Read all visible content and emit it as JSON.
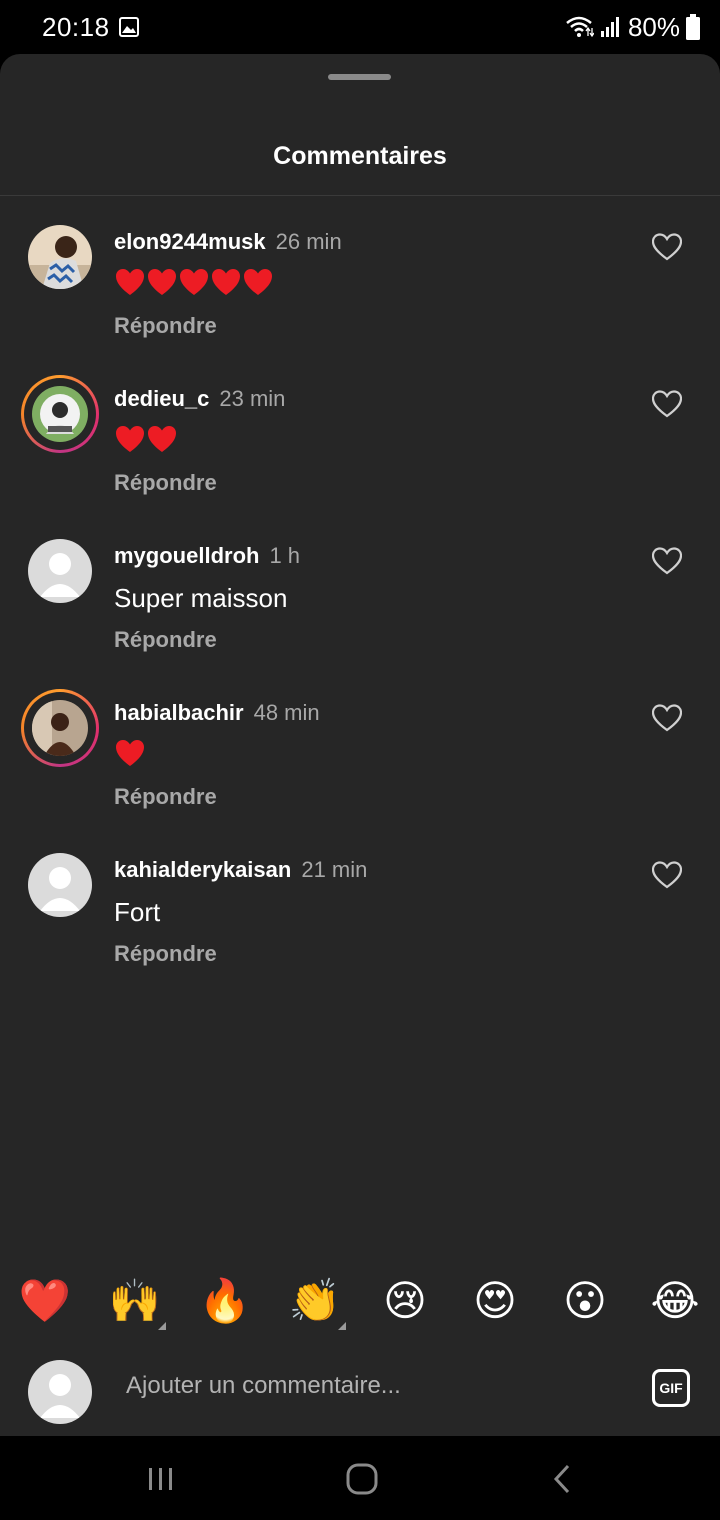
{
  "status_bar": {
    "time": "20:18",
    "battery": "80%",
    "icons": [
      "gallery-icon",
      "wifi-icon",
      "signal-icon",
      "battery-icon"
    ]
  },
  "sheet": {
    "title": "Commentaires"
  },
  "comments": [
    {
      "username": "elon9244musk",
      "time": "26 min",
      "text": "",
      "hearts": 5,
      "reply": "Répondre",
      "has_story_ring": false
    },
    {
      "username": "dedieu_c",
      "time": "23 min",
      "text": "",
      "hearts": 2,
      "reply": "Répondre",
      "has_story_ring": true
    },
    {
      "username": "mygouelldroh",
      "time": "1 h",
      "text": "Super maisson",
      "hearts": 0,
      "reply": "Répondre",
      "has_story_ring": false
    },
    {
      "username": "habialbachir",
      "time": "48 min",
      "text": "",
      "hearts": 1,
      "reply": "Répondre",
      "has_story_ring": true
    },
    {
      "username": "kahialderykaisan",
      "time": "21 min",
      "text": "Fort",
      "hearts": 0,
      "reply": "Répondre",
      "has_story_ring": false
    }
  ],
  "reactions": [
    {
      "emoji": "❤️",
      "name": "red-heart"
    },
    {
      "emoji": "🙌",
      "name": "raising-hands",
      "has_variants": true
    },
    {
      "emoji": "🔥",
      "name": "fire"
    },
    {
      "emoji": "👏",
      "name": "clapping-hands",
      "has_variants": true
    },
    {
      "emoji": "😢",
      "name": "crying-face"
    },
    {
      "emoji": "😍",
      "name": "heart-eyes"
    },
    {
      "emoji": "😮",
      "name": "surprised-face"
    },
    {
      "emoji": "😂",
      "name": "tears-of-joy"
    }
  ],
  "input": {
    "placeholder": "Ajouter un commentaire...",
    "gif_label": "GIF"
  },
  "colors": {
    "sheet_bg": "#262626",
    "muted_text": "#a8a8a8",
    "heart_red": "#ed1c24"
  }
}
